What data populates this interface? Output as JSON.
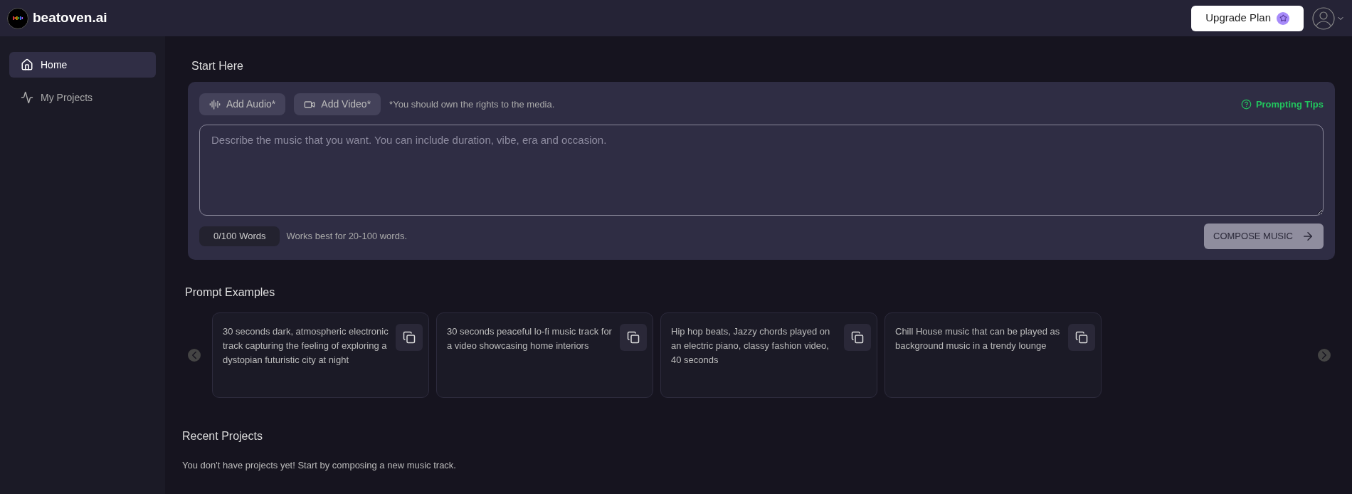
{
  "header": {
    "logo_text": "beatoven.ai",
    "upgrade_button": "Upgrade Plan"
  },
  "sidebar": {
    "items": [
      {
        "label": "Home",
        "selected": true
      },
      {
        "label": "My Projects",
        "selected": false
      }
    ]
  },
  "start_here": {
    "title": "Start Here",
    "add_audio": "Add Audio*",
    "add_video": "Add Video*",
    "rights_note": "*You should own the rights to the media.",
    "prompting_tips": "Prompting Tips",
    "placeholder": "Describe the music that you want. You can include duration, vibe, era and occasion.",
    "word_count": "0/100 Words",
    "word_hint": "Works best for 20-100 words.",
    "compose_button": "COMPOSE MUSIC",
    "compose_disabled": true
  },
  "prompt_examples": {
    "title": "Prompt Examples",
    "items": [
      {
        "text": "30 seconds dark, atmospheric electronic track capturing the feeling of exploring a dystopian futuristic city at night"
      },
      {
        "text": "30 seconds peaceful lo-fi music track for a video showcasing home interiors"
      },
      {
        "text": "Hip hop beats, Jazzy chords played on an electric piano, classy fashion video, 40 seconds"
      },
      {
        "text": "Chill House music that can be played as background music in a trendy lounge"
      }
    ]
  },
  "recent_projects": {
    "title": "Recent Projects",
    "empty_message": "You don't have projects yet! Start by composing a new music track."
  }
}
